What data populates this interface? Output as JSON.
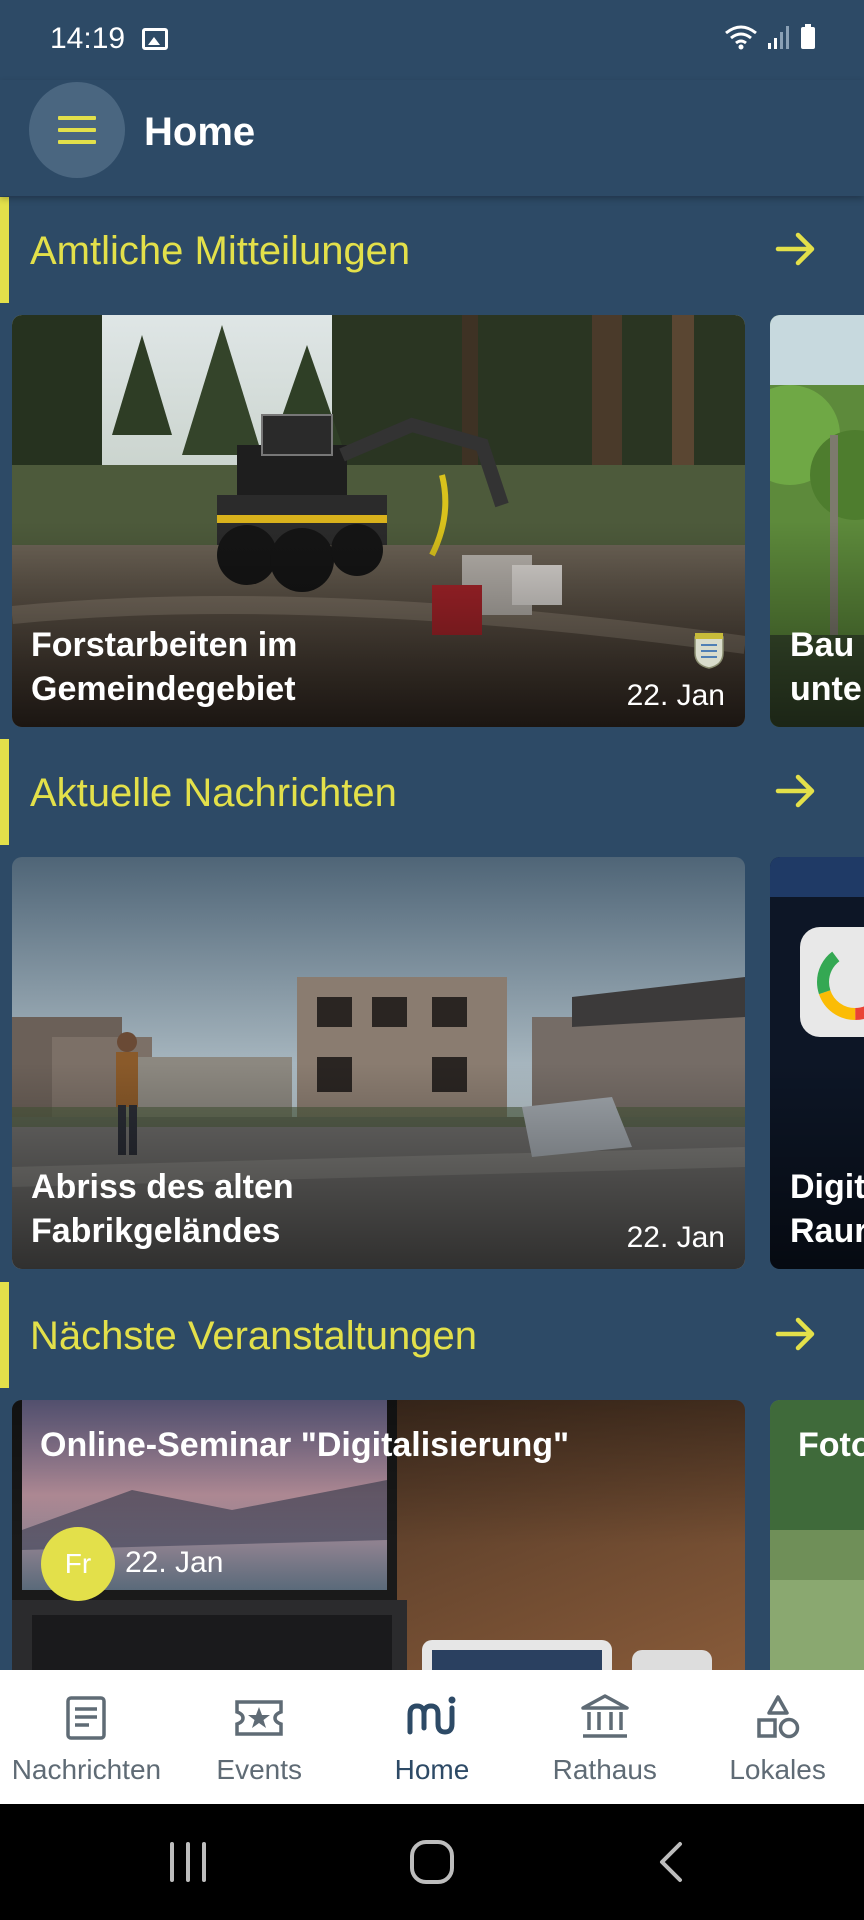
{
  "status_bar": {
    "time": "14:19"
  },
  "app_bar": {
    "title": "Home",
    "menu_icon": "hamburger-icon"
  },
  "colors": {
    "background": "#2d4a66",
    "accent": "#e3e04a",
    "nav_active": "#2d4a66"
  },
  "sections": [
    {
      "title": "Amtliche Mitteilungen",
      "cards": [
        {
          "title": "Forstarbeiten im Gemeindegebiet",
          "date": "22. Jan"
        },
        {
          "title": "Bau\nunte"
        }
      ]
    },
    {
      "title": "Aktuelle Nachrichten",
      "cards": [
        {
          "title": "Abriss des alten Fabrikgeländes",
          "date": "22. Jan"
        },
        {
          "title": "Digit\nRaur"
        }
      ]
    },
    {
      "title": "Nächste Veranstaltungen",
      "cards": [
        {
          "title": "Online-Seminar \"Digitalisierung\"",
          "weekday": "Fr",
          "date": "22. Jan"
        },
        {
          "title": "Foto"
        }
      ]
    }
  ],
  "bottom_nav": {
    "items": [
      {
        "label": "Nachrichten",
        "icon": "news-icon"
      },
      {
        "label": "Events",
        "icon": "events-icon"
      },
      {
        "label": "Home",
        "icon": "home-logo-icon",
        "active": true
      },
      {
        "label": "Rathaus",
        "icon": "town-hall-icon"
      },
      {
        "label": "Lokales",
        "icon": "local-icon"
      }
    ]
  }
}
